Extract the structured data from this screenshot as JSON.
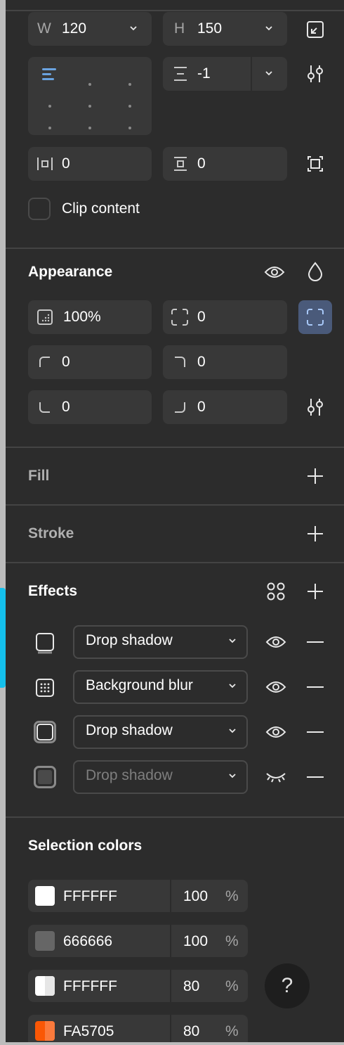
{
  "layout_section": {
    "width": {
      "label": "W",
      "value": "120"
    },
    "height": {
      "label": "H",
      "value": "150"
    },
    "gap": {
      "value": "-1"
    },
    "padding_horizontal": {
      "value": "0"
    },
    "padding_vertical": {
      "value": "0"
    },
    "clip_content": {
      "label": "Clip content",
      "checked": false
    }
  },
  "appearance": {
    "title": "Appearance",
    "opacity": "100%",
    "corner_radius": "0",
    "corners": {
      "top_left": "0",
      "top_right": "0",
      "bottom_left": "0",
      "bottom_right": "0"
    }
  },
  "fill": {
    "title": "Fill"
  },
  "stroke": {
    "title": "Stroke"
  },
  "effects": {
    "title": "Effects",
    "items": [
      {
        "type": "Drop shadow",
        "visible": true
      },
      {
        "type": "Background blur",
        "visible": true
      },
      {
        "type": "Drop shadow",
        "visible": true
      },
      {
        "type": "Drop shadow",
        "visible": false
      }
    ]
  },
  "selection_colors": {
    "title": "Selection colors",
    "items": [
      {
        "hex": "FFFFFF",
        "opacity": "100",
        "unit": "%",
        "swatch": "#ffffff"
      },
      {
        "hex": "666666",
        "opacity": "100",
        "unit": "%",
        "swatch": "#666666"
      },
      {
        "hex": "FFFFFF",
        "opacity": "80",
        "unit": "%",
        "swatch": "#ffffff"
      },
      {
        "hex": "FA5705",
        "opacity": "80",
        "unit": "%",
        "swatch": "#fa5705"
      }
    ]
  },
  "help": {
    "label": "?"
  },
  "colors": {
    "panel": "#2c2c2c",
    "field": "#383838",
    "accent": "#4a5a7a",
    "alignment_active": "#6aa3e0"
  }
}
